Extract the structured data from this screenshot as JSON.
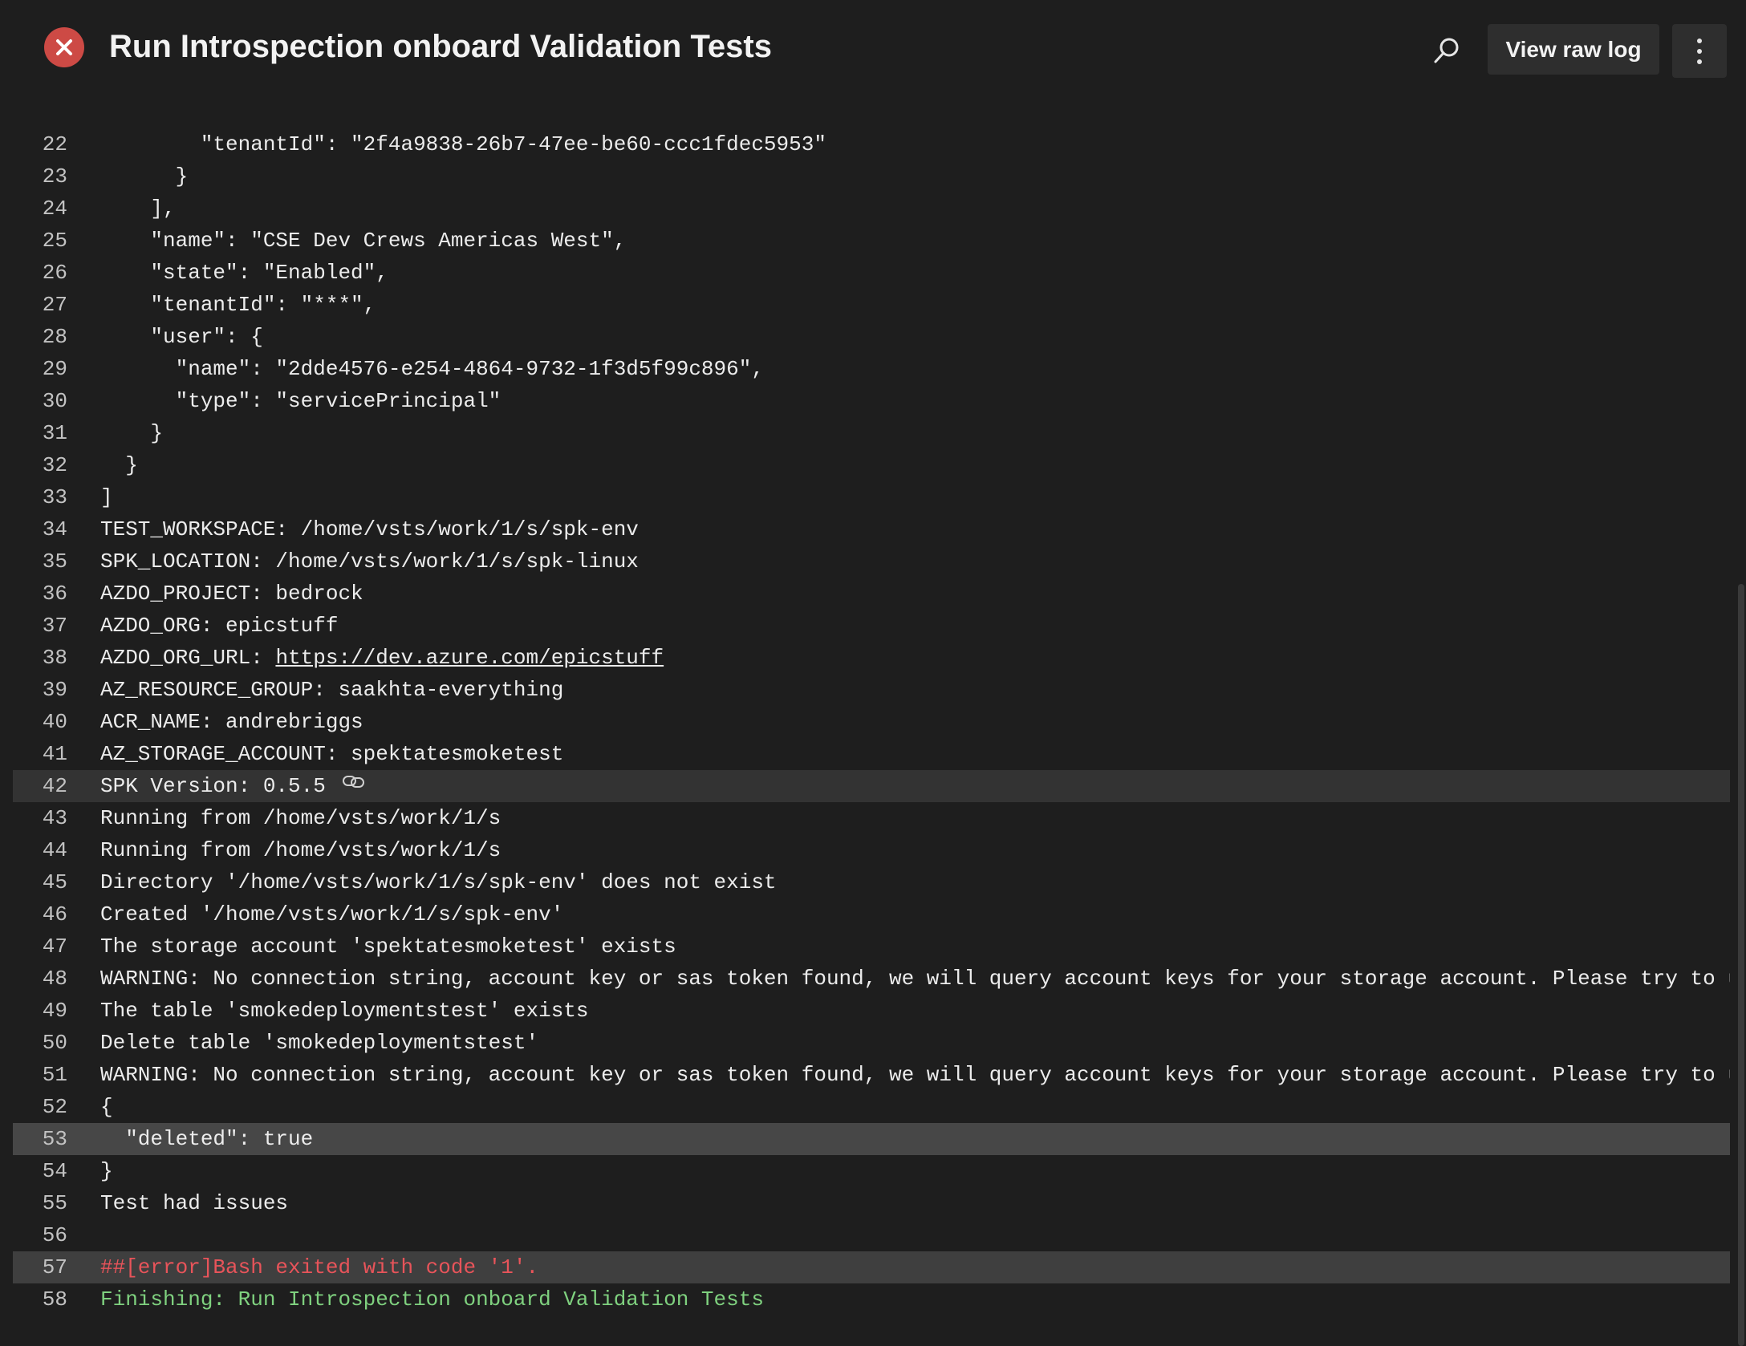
{
  "header": {
    "title": "Run Introspection onboard Validation Tests",
    "status": "failed",
    "status_icon": "close-icon",
    "view_raw_log_label": "View raw log",
    "search_icon": "search-icon",
    "more_icon": "more-vertical-icon"
  },
  "colors": {
    "background": "#1e1e1e",
    "status_failed": "#cd4a45",
    "error_text": "#e8545a",
    "success_text": "#7fd17f"
  },
  "log": {
    "lines": [
      {
        "num": "22",
        "text": "        \"tenantId\": \"2f4a9838-26b7-47ee-be60-ccc1fdec5953\""
      },
      {
        "num": "23",
        "text": "      }"
      },
      {
        "num": "24",
        "text": "    ],"
      },
      {
        "num": "25",
        "text": "    \"name\": \"CSE Dev Crews Americas West\","
      },
      {
        "num": "26",
        "text": "    \"state\": \"Enabled\","
      },
      {
        "num": "27",
        "text": "    \"tenantId\": \"***\","
      },
      {
        "num": "28",
        "text": "    \"user\": {"
      },
      {
        "num": "29",
        "text": "      \"name\": \"2dde4576-e254-4864-9732-1f3d5f99c896\","
      },
      {
        "num": "30",
        "text": "      \"type\": \"servicePrincipal\""
      },
      {
        "num": "31",
        "text": "    }"
      },
      {
        "num": "32",
        "text": "  }"
      },
      {
        "num": "33",
        "text": "]"
      },
      {
        "num": "34",
        "text": "TEST_WORKSPACE: /home/vsts/work/1/s/spk-env"
      },
      {
        "num": "35",
        "text": "SPK_LOCATION: /home/vsts/work/1/s/spk-linux"
      },
      {
        "num": "36",
        "text": "AZDO_PROJECT: bedrock"
      },
      {
        "num": "37",
        "text": "AZDO_ORG: epicstuff"
      },
      {
        "num": "38",
        "prefix": "AZDO_ORG_URL: ",
        "link": "https://dev.azure.com/epicstuff"
      },
      {
        "num": "39",
        "text": "AZ_RESOURCE_GROUP: saakhta-everything"
      },
      {
        "num": "40",
        "text": "ACR_NAME: andrebriggs"
      },
      {
        "num": "41",
        "text": "AZ_STORAGE_ACCOUNT: spektatesmoketest"
      },
      {
        "num": "42",
        "text": "SPK Version: 0.5.5",
        "state": "highlight",
        "has_link_icon": true
      },
      {
        "num": "43",
        "text": "Running from /home/vsts/work/1/s"
      },
      {
        "num": "44",
        "text": "Running from /home/vsts/work/1/s"
      },
      {
        "num": "45",
        "text": "Directory '/home/vsts/work/1/s/spk-env' does not exist"
      },
      {
        "num": "46",
        "text": "Created '/home/vsts/work/1/s/spk-env'"
      },
      {
        "num": "47",
        "text": "The storage account 'spektatesmoketest' exists"
      },
      {
        "num": "48",
        "text": "WARNING: No connection string, account key or sas token found, we will query account keys for your storage account. Please try to use --auth-"
      },
      {
        "num": "49",
        "text": "The table 'smokedeploymentstest' exists"
      },
      {
        "num": "50",
        "text": "Delete table 'smokedeploymentstest'"
      },
      {
        "num": "51",
        "text": "WARNING: No connection string, account key or sas token found, we will query account keys for your storage account. Please try to use --auth-"
      },
      {
        "num": "52",
        "text": "{"
      },
      {
        "num": "53",
        "text": "  \"deleted\": true",
        "state": "selected"
      },
      {
        "num": "54",
        "text": "}"
      },
      {
        "num": "55",
        "text": "Test had issues"
      },
      {
        "num": "56",
        "text": ""
      },
      {
        "num": "57",
        "text": "##[error]Bash exited with code '1'.",
        "state": "error-hl",
        "kind": "error"
      },
      {
        "num": "58",
        "text": "Finishing: Run Introspection onboard Validation Tests",
        "kind": "success"
      }
    ]
  }
}
